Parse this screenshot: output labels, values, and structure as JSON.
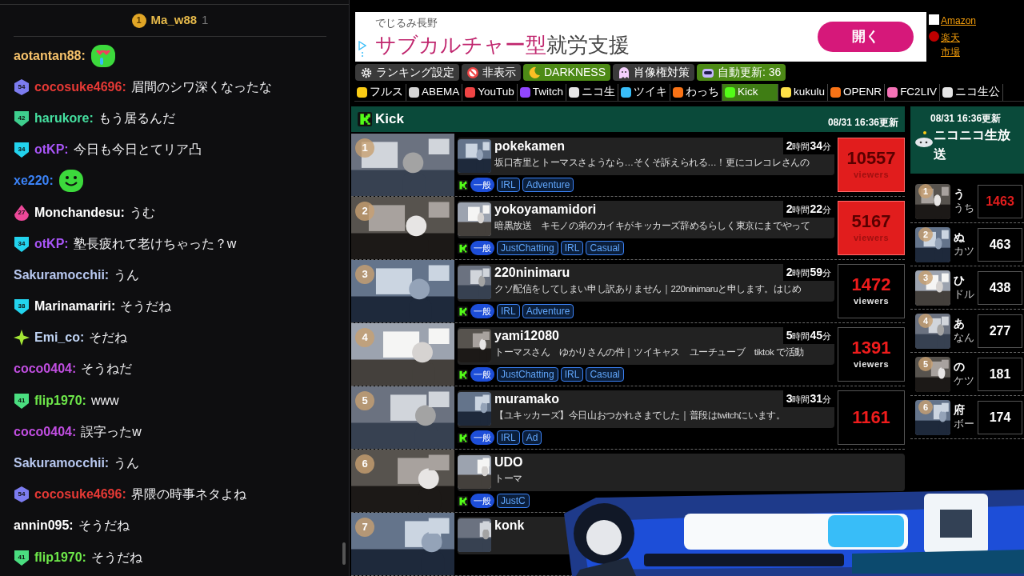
{
  "chat": {
    "header": {
      "rank": "1",
      "user": "Ma_w88",
      "count": "1"
    },
    "messages": [
      {
        "kind": "heart_eyes",
        "user": "aotantan88:",
        "color": "#f6c26b"
      },
      {
        "kind": "text",
        "badge": {
          "kind": "hex",
          "number": "54",
          "color": "#7c7cf0"
        },
        "user": "cocosuke4696:",
        "color": "#e53935",
        "text": "眉間のシワ深くなったな"
      },
      {
        "kind": "text",
        "badge": {
          "kind": "shield",
          "number": "42",
          "color": "#3ecf8e"
        },
        "user": "harukore:",
        "color": "#45e0a0",
        "text": "もう居るんだ"
      },
      {
        "kind": "text",
        "badge": {
          "kind": "shield",
          "number": "34",
          "color": "#22d3ee"
        },
        "user": "otKP:",
        "color": "#a855f7",
        "text": "今日も今日とてリア凸"
      },
      {
        "kind": "smile",
        "user": "xe220:",
        "color": "#3b82f6"
      },
      {
        "kind": "text",
        "badge": {
          "kind": "drop",
          "number": "27",
          "color": "#ec4899"
        },
        "user": "Monchandesu:",
        "color": "#ffffff",
        "text": "うむ"
      },
      {
        "kind": "text",
        "badge": {
          "kind": "shield",
          "number": "34",
          "color": "#22d3ee"
        },
        "user": "otKP:",
        "color": "#a855f7",
        "text": "塾長疲れて老けちゃった？w"
      },
      {
        "kind": "text",
        "user": "Sakuramocchii:",
        "color": "#b8c8f0",
        "text": "うん"
      },
      {
        "kind": "text",
        "badge": {
          "kind": "shield",
          "number": "38",
          "color": "#22d3ee"
        },
        "user": "Marinamariri:",
        "color": "#ffffff",
        "text": "そうだね"
      },
      {
        "kind": "text",
        "badge": {
          "kind": "sparkle",
          "color": "#a3e635"
        },
        "user": "Emi_co:",
        "color": "#c0d4f4",
        "text": "そだね"
      },
      {
        "kind": "text",
        "user": "coco0404:",
        "color": "#c04ee0",
        "text": "そうねだ"
      },
      {
        "kind": "text",
        "badge": {
          "kind": "shield",
          "number": "41",
          "color": "#4ade80"
        },
        "user": "flip1970:",
        "color": "#6ee84a",
        "text": "www"
      },
      {
        "kind": "text",
        "user": "coco0404:",
        "color": "#c04ee0",
        "text": "誤字ったw"
      },
      {
        "kind": "text",
        "user": "Sakuramocchii:",
        "color": "#b8c8f0",
        "text": "うん"
      },
      {
        "kind": "text",
        "badge": {
          "kind": "hex",
          "number": "54",
          "color": "#7c7cf0"
        },
        "user": "cocosuke4696:",
        "color": "#e53935",
        "text": "界隈の時事ネタよね"
      },
      {
        "kind": "text",
        "user": "annin095:",
        "color": "#ffffff",
        "text": "そうだね"
      },
      {
        "kind": "text",
        "badge": {
          "kind": "shield",
          "number": "41",
          "color": "#4ade80"
        },
        "user": "flip1970:",
        "color": "#6ee84a",
        "text": "そうだね"
      }
    ]
  },
  "ad": {
    "advertiser": "でじるみ長野",
    "headline_accent": "サブカルチャー型",
    "headline_rest": "就労支援",
    "button": "開く"
  },
  "shop_links": [
    {
      "label": "Amazon"
    },
    {
      "label": "楽天市場"
    }
  ],
  "toolbar": [
    {
      "kind": "gear",
      "label": "ランキング設定",
      "on": false
    },
    {
      "kind": "block",
      "label": "非表示",
      "on": false
    },
    {
      "kind": "moon",
      "label": "DARKNESS",
      "on": true
    },
    {
      "kind": "ghost",
      "label": "肖像権対策",
      "on": false
    },
    {
      "kind": "robot",
      "label": "自動更新: 36",
      "on": true
    }
  ],
  "platform_tabs": [
    {
      "label": "フルス",
      "color": "#facc15",
      "selected": false
    },
    {
      "label": "ABEMA",
      "color": "#d4d4d4",
      "selected": false
    },
    {
      "label": "YouTub",
      "color": "#ef4444",
      "selected": false
    },
    {
      "label": "Twitch",
      "color": "#9146ff",
      "selected": false
    },
    {
      "label": "ニコ生",
      "color": "#e5e5e5",
      "selected": false
    },
    {
      "label": "ツイキ",
      "color": "#38bdf8",
      "selected": false
    },
    {
      "label": "わっち",
      "color": "#f97316",
      "selected": false
    },
    {
      "label": "Kick",
      "color": "#53fc18",
      "selected": true
    },
    {
      "label": "kukulu",
      "color": "#fde047",
      "selected": false
    },
    {
      "label": "OPENR",
      "color": "#f97316",
      "selected": false
    },
    {
      "label": "FC2LIV",
      "color": "#f472b6",
      "selected": false
    },
    {
      "label": "ニコ生公",
      "color": "#e5e5e5",
      "selected": false
    }
  ],
  "kick": {
    "title": "Kick",
    "updated": "08/31 16:36更新",
    "streams": [
      {
        "rank": "1",
        "name": "pokekamen",
        "duration": "**2**時間**34**分",
        "title": "坂口杏里とトーマスさようなら…そくそ訴えられる…！更にコレコレさんの",
        "category": "一般",
        "tags": [
          "IRL",
          "Adventure"
        ],
        "viewers": "10557",
        "viewers_label": "viewers",
        "highlighted": true
      },
      {
        "rank": "2",
        "name": "yokoyamamidori",
        "duration": "**2**時間**22**分",
        "title": "暗黒放送　キモノの弟のカイキがキッカーズ辞めるらしく東京にまでやって",
        "category": "一般",
        "tags": [
          "JustChatting",
          "IRL",
          "Casual"
        ],
        "viewers": "5167",
        "viewers_label": "viewers",
        "highlighted": true
      },
      {
        "rank": "3",
        "name": "220ninimaru",
        "duration": "**2**時間**59**分",
        "title": "クソ配信をしてしまい申し訳ありません｜220ninimaruと申します。はじめ",
        "category": "一般",
        "tags": [
          "IRL",
          "Adventure"
        ],
        "viewers": "1472",
        "viewers_label": "viewers",
        "highlighted": false
      },
      {
        "rank": "4",
        "name": "yami12080",
        "duration": "**5**時間**45**分",
        "title": "トーマスさん　ゆかりさんの件｜ツイキャス　ユーチューブ　tiktok で活動",
        "category": "一般",
        "tags": [
          "JustChatting",
          "IRL",
          "Casual"
        ],
        "viewers": "1391",
        "viewers_label": "viewers",
        "highlighted": false
      },
      {
        "rank": "5",
        "name": "muramako",
        "duration": "**3**時間**31**分",
        "title": "【ユキッカーズ】今日山おつかれさまでした｜普段はtwitchにいます。",
        "category": "一般",
        "tags": [
          "IRL",
          "Ad"
        ],
        "viewers": "1161",
        "highlighted": false
      },
      {
        "rank": "6",
        "name": "UDO",
        "title": "トーマ",
        "category": "一般",
        "tags": [
          "JustC"
        ]
      },
      {
        "rank": "7",
        "name": "konk"
      }
    ]
  },
  "niconico": {
    "title": "ニコニコ生放送",
    "updated": "08/31 16:36更新",
    "streams": [
      {
        "rank": "1",
        "name": "う",
        "sub": "うち",
        "viewers": "1463",
        "highlighted": true
      },
      {
        "rank": "2",
        "name": "ぬ",
        "sub": "カツ",
        "viewers": "463",
        "highlighted": false
      },
      {
        "rank": "3",
        "name": "ひ",
        "sub": "ドル",
        "viewers": "438",
        "highlighted": false
      },
      {
        "rank": "4",
        "name": "あ",
        "sub": "なん",
        "viewers": "277",
        "highlighted": false
      },
      {
        "rank": "5",
        "name": "の",
        "sub": "ケツ",
        "viewers": "181",
        "highlighted": false
      },
      {
        "rank": "6",
        "name": "府",
        "sub": "ボー",
        "viewers": "174",
        "highlighted": false
      }
    ]
  }
}
